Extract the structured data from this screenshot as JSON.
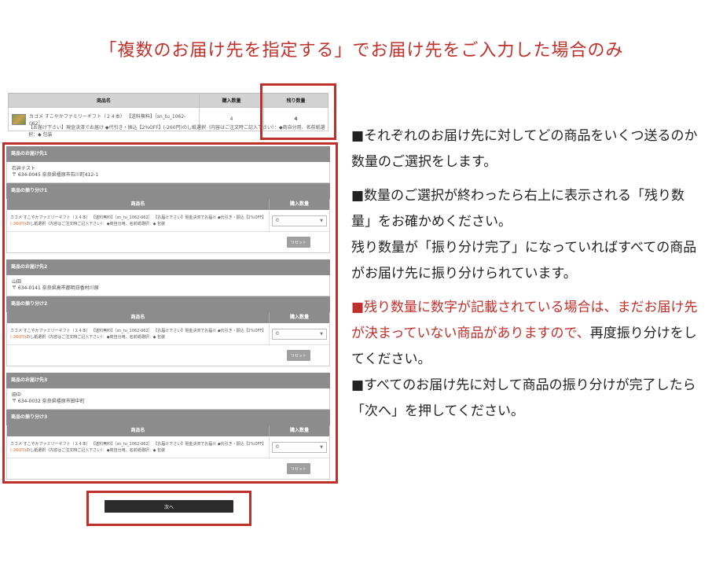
{
  "title": "「複数のお届け先を指定する」でお届け先をご入力した場合のみ",
  "order": {
    "headers": [
      "商品名",
      "購入数量",
      "残り数量"
    ],
    "product_name": "カゴメ すこやかファミリーギフト（２４本） 【送料無料】［sn_tu_1062-062］",
    "purchase_qty": "4",
    "remaining_qty": "4",
    "options": "【お届け下さい】現金決済でお届け ◆代引き・振込【2%OFF】(-260円)のし紙選択（内容はご注文時ご記入下さい）：◆商自分用、名前紙選択：◆ 包装"
  },
  "recipients": [
    {
      "heading": "商品のお届け先1",
      "name": "石井テスト",
      "address": "〒 634-0045 奈良県橿原市石川町412-1",
      "alloc_heading": "商品の振り分け1"
    },
    {
      "heading": "商品のお届け先2",
      "name": "山田",
      "address": "〒 634-0141 奈良県高市郡明日香村川原",
      "alloc_heading": "商品の振り分け2"
    },
    {
      "heading": "商品のお届け先3",
      "name": "田中",
      "address": "〒 634-0032 奈良県橿原市田中町",
      "alloc_heading": "商品の振り分け3"
    }
  ],
  "alloc": {
    "col_product": "商品名",
    "col_qty": "購入数量",
    "line_1": "カゴメ すこやかファミリーギフト（２４本） 【送料無料】［sn_tu_1062-062］ 【お届け下さい】現金決済でお届け ◆代引き・振込【2%OFF】",
    "price": "(-260円)",
    "line_2": "のし紙選択（内容はご注文時ご記入下さい）：◆商自分用、名前紙選択：◆ 包装",
    "select_value": "0",
    "reset_label": "リセット"
  },
  "next_label": "次へ",
  "instructions": {
    "p1": "■それぞれのお届け先に対してどの商品をいくつ送るのか数量のご選択をします。",
    "p2": "■数量のご選択が終わったら右上に表示される「残り数量」をお確かめください。",
    "p3": "残り数量が「振り分け完了」になっていればすべての商品がお届け先に振り分けられています。",
    "p4_red": "■残り数量に数字が記載されている場合は、まだお届け先が決まっていない商品がありますので、",
    "p4_rest": "再度振り分けをしてください。",
    "p5": "■すべてのお届け先に対して商品の振り分けが完了したら「次へ」を押してください。"
  },
  "colors": {
    "accent": "#c0302a",
    "header_gray": "#8c8c8c",
    "button_dark": "#2c2c2c"
  }
}
